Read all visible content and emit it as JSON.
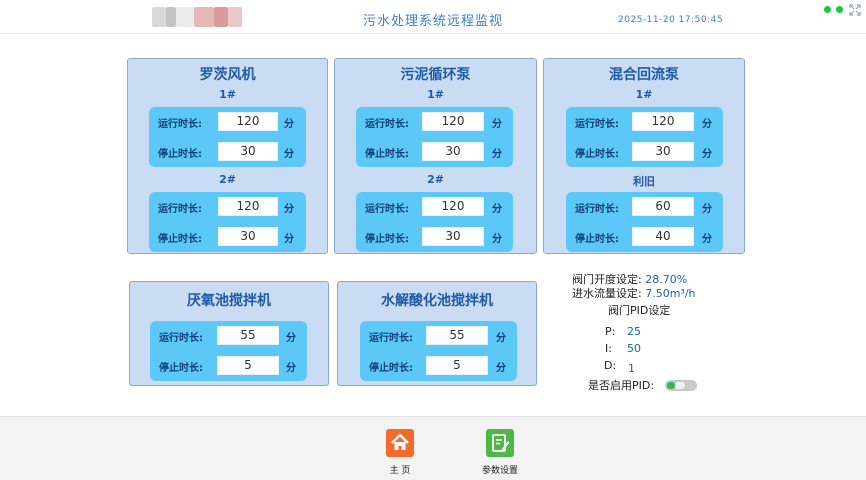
{
  "header": {
    "title": "污水处理系统远程监视",
    "datetime": "2025-11-20 17:50:45"
  },
  "panels": {
    "luocifengji": {
      "title": "罗茨风机",
      "groups": [
        {
          "label": "1#",
          "run_label": "运行时长:",
          "run_value": "120",
          "stop_label": "停止时长:",
          "stop_value": "30",
          "unit": "分"
        },
        {
          "label": "2#",
          "run_label": "运行时长:",
          "run_value": "120",
          "stop_label": "停止时长:",
          "stop_value": "30",
          "unit": "分"
        }
      ]
    },
    "wunixunhuan": {
      "title": "污泥循环泵",
      "groups": [
        {
          "label": "1#",
          "run_label": "运行时长:",
          "run_value": "120",
          "stop_label": "停止时长:",
          "stop_value": "30",
          "unit": "分"
        },
        {
          "label": "2#",
          "run_label": "运行时长:",
          "run_value": "120",
          "stop_label": "停止时长:",
          "stop_value": "30",
          "unit": "分"
        }
      ]
    },
    "hunhehuiliu": {
      "title": "混合回流泵",
      "groups": [
        {
          "label": "1#",
          "run_label": "运行时长:",
          "run_value": "120",
          "stop_label": "停止时长:",
          "stop_value": "30",
          "unit": "分"
        },
        {
          "label": "利旧",
          "run_label": "运行时长:",
          "run_value": "60",
          "stop_label": "停止时长:",
          "stop_value": "40",
          "unit": "分"
        }
      ]
    },
    "yanyangchi": {
      "title": "厌氧池搅拌机",
      "run_label": "运行时长:",
      "run_value": "55",
      "stop_label": "停止时长:",
      "stop_value": "5",
      "unit": "分"
    },
    "shuijiesuanhua": {
      "title": "水解酸化池搅拌机",
      "run_label": "运行时长:",
      "run_value": "55",
      "stop_label": "停止时长:",
      "stop_value": "5",
      "unit": "分"
    }
  },
  "settings": {
    "valve_label": "阀门开度设定:",
    "valve_value": "28.70%",
    "flow_label": "进水流量设定:",
    "flow_value": "7.50m³/h",
    "pid_title": "阀门PID设定",
    "p_label": "P:",
    "p_value": "25",
    "i_label": "I:",
    "i_value": "50",
    "d_label": "D:",
    "d_value": "1",
    "pid_enable_label": "是否启用PID:",
    "pid_enabled": true
  },
  "footer": {
    "home_label": "主 页",
    "params_label": "参数设置"
  },
  "colors": {
    "title_blue": "#3d7fc7",
    "panel_bg": "#c9dcf4",
    "inner_bg": "#5cc8f7",
    "home_icon": "#f26b2a",
    "params_icon": "#4fb748",
    "status_green": "#17c93e"
  },
  "icons": {
    "home": "home-icon",
    "params": "edit-document-icon",
    "expand": "expand-icon"
  }
}
